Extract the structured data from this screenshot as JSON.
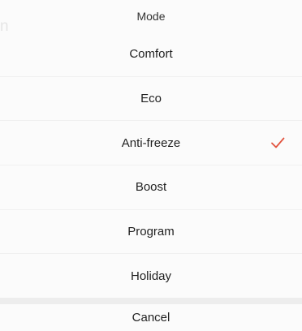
{
  "backdrop": {
    "partial_text": "n"
  },
  "sheet": {
    "title": "Mode",
    "options": [
      {
        "label": "Comfort",
        "selected": false
      },
      {
        "label": "Eco",
        "selected": false
      },
      {
        "label": "Anti-freeze",
        "selected": true
      },
      {
        "label": "Boost",
        "selected": false
      },
      {
        "label": "Program",
        "selected": false
      },
      {
        "label": "Holiday",
        "selected": false
      }
    ],
    "cancel_label": "Cancel",
    "selected_option": "Anti-freeze",
    "check_icon": "checkmark-icon"
  },
  "colors": {
    "accent": "#e2533e",
    "sheet_background": "#fbfbfb",
    "text": "#1f1f1f"
  }
}
